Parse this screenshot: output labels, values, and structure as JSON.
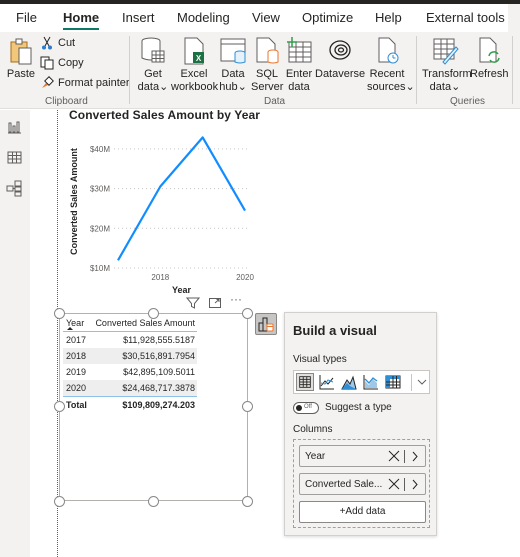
{
  "menu": {
    "tabs": [
      {
        "label": "File",
        "active": false
      },
      {
        "label": "Home",
        "active": true
      },
      {
        "label": "Insert",
        "active": false
      },
      {
        "label": "Modeling",
        "active": false
      },
      {
        "label": "View",
        "active": false
      },
      {
        "label": "Optimize",
        "active": false
      },
      {
        "label": "Help",
        "active": false
      },
      {
        "label": "External tools",
        "active": false
      }
    ]
  },
  "ribbon": {
    "clipboard": {
      "group_label": "Clipboard",
      "paste": {
        "label": "Paste",
        "icon": "paste-icon"
      },
      "cut": {
        "label": "Cut",
        "icon": "scissors-icon"
      },
      "copy": {
        "label": "Copy",
        "icon": "copy-icon"
      },
      "format_painter": {
        "label": "Format painter",
        "icon": "paintbrush-icon"
      }
    },
    "data": {
      "group_label": "Data",
      "buttons": [
        {
          "line1": "Get",
          "line2": "data",
          "dropdown": true,
          "icon": "database-icon"
        },
        {
          "line1": "Excel",
          "line2": "workbook",
          "dropdown": false,
          "icon": "excel-icon"
        },
        {
          "line1": "Data",
          "line2": "hub",
          "dropdown": true,
          "icon": "data-hub-icon"
        },
        {
          "line1": "SQL",
          "line2": "Server",
          "dropdown": false,
          "icon": "sql-server-icon"
        },
        {
          "line1": "Enter",
          "line2": "data",
          "dropdown": false,
          "icon": "enter-data-icon"
        },
        {
          "line1": "Dataverse",
          "line2": "",
          "dropdown": false,
          "icon": "dataverse-icon"
        },
        {
          "line1": "Recent",
          "line2": "sources",
          "dropdown": true,
          "icon": "recent-sources-icon"
        }
      ]
    },
    "queries": {
      "group_label": "Queries",
      "buttons": [
        {
          "line1": "Transform",
          "line2": "data",
          "dropdown": true,
          "icon": "transform-data-icon"
        },
        {
          "line1": "Refresh",
          "line2": "",
          "dropdown": false,
          "icon": "refresh-icon"
        }
      ]
    },
    "dropdown_glyph": "⌄"
  },
  "left_rail": {
    "items": [
      {
        "name": "report-view",
        "icon": "bar-chart-icon"
      },
      {
        "name": "table-view",
        "icon": "table-icon"
      },
      {
        "name": "model-view",
        "icon": "model-icon"
      }
    ]
  },
  "chart_data": {
    "type": "line",
    "title": "Converted Sales Amount by Year",
    "xlabel": "Year",
    "ylabel": "Converted Sales Amount",
    "x": [
      2017,
      2018,
      2019,
      2020
    ],
    "series": [
      {
        "name": "Converted Sales Amount",
        "values": [
          11928555.5187,
          30516891.7954,
          42895109.5011,
          24468717.3878
        ],
        "color": "#118dff"
      }
    ],
    "x_ticks": [
      "2018",
      "2020"
    ],
    "x_tick_values": [
      2018,
      2020
    ],
    "y_ticks": [
      "$10M",
      "$20M",
      "$30M",
      "$40M"
    ],
    "y_tick_values": [
      10000000,
      20000000,
      30000000,
      40000000
    ],
    "xlim": [
      2017,
      2020
    ],
    "ylim": [
      10000000,
      43500000
    ],
    "grid": true,
    "legend": "none"
  },
  "table_visual": {
    "columns": [
      "Year",
      "Converted Sales Amount"
    ],
    "rows": [
      [
        "2017",
        "$11,928,555.5187"
      ],
      [
        "2018",
        "$30,516,891.7954"
      ],
      [
        "2019",
        "$42,895,109.5011"
      ],
      [
        "2020",
        "$24,468,717.3878"
      ]
    ],
    "total": {
      "label": "Total",
      "value": "$109,809,274.203"
    },
    "sort": "ascending by Year"
  },
  "visual_header": {
    "icons": [
      "filter-icon",
      "focus-mode-icon",
      "more-options-icon"
    ],
    "more_glyph": "···"
  },
  "build_visual": {
    "title": "Build a visual",
    "visual_types_label": "Visual types",
    "visual_types": [
      {
        "name": "table",
        "selected": true
      },
      {
        "name": "line-chart",
        "selected": false
      },
      {
        "name": "area-chart",
        "selected": false
      },
      {
        "name": "line-area-chart",
        "selected": false
      },
      {
        "name": "matrix",
        "selected": false
      }
    ],
    "suggest": {
      "label": "Suggest a type",
      "state": "Off"
    },
    "columns_label": "Columns",
    "fields": [
      {
        "label": "Year"
      },
      {
        "label": "Converted Sale..."
      }
    ],
    "add_data_label": "+Add data"
  }
}
